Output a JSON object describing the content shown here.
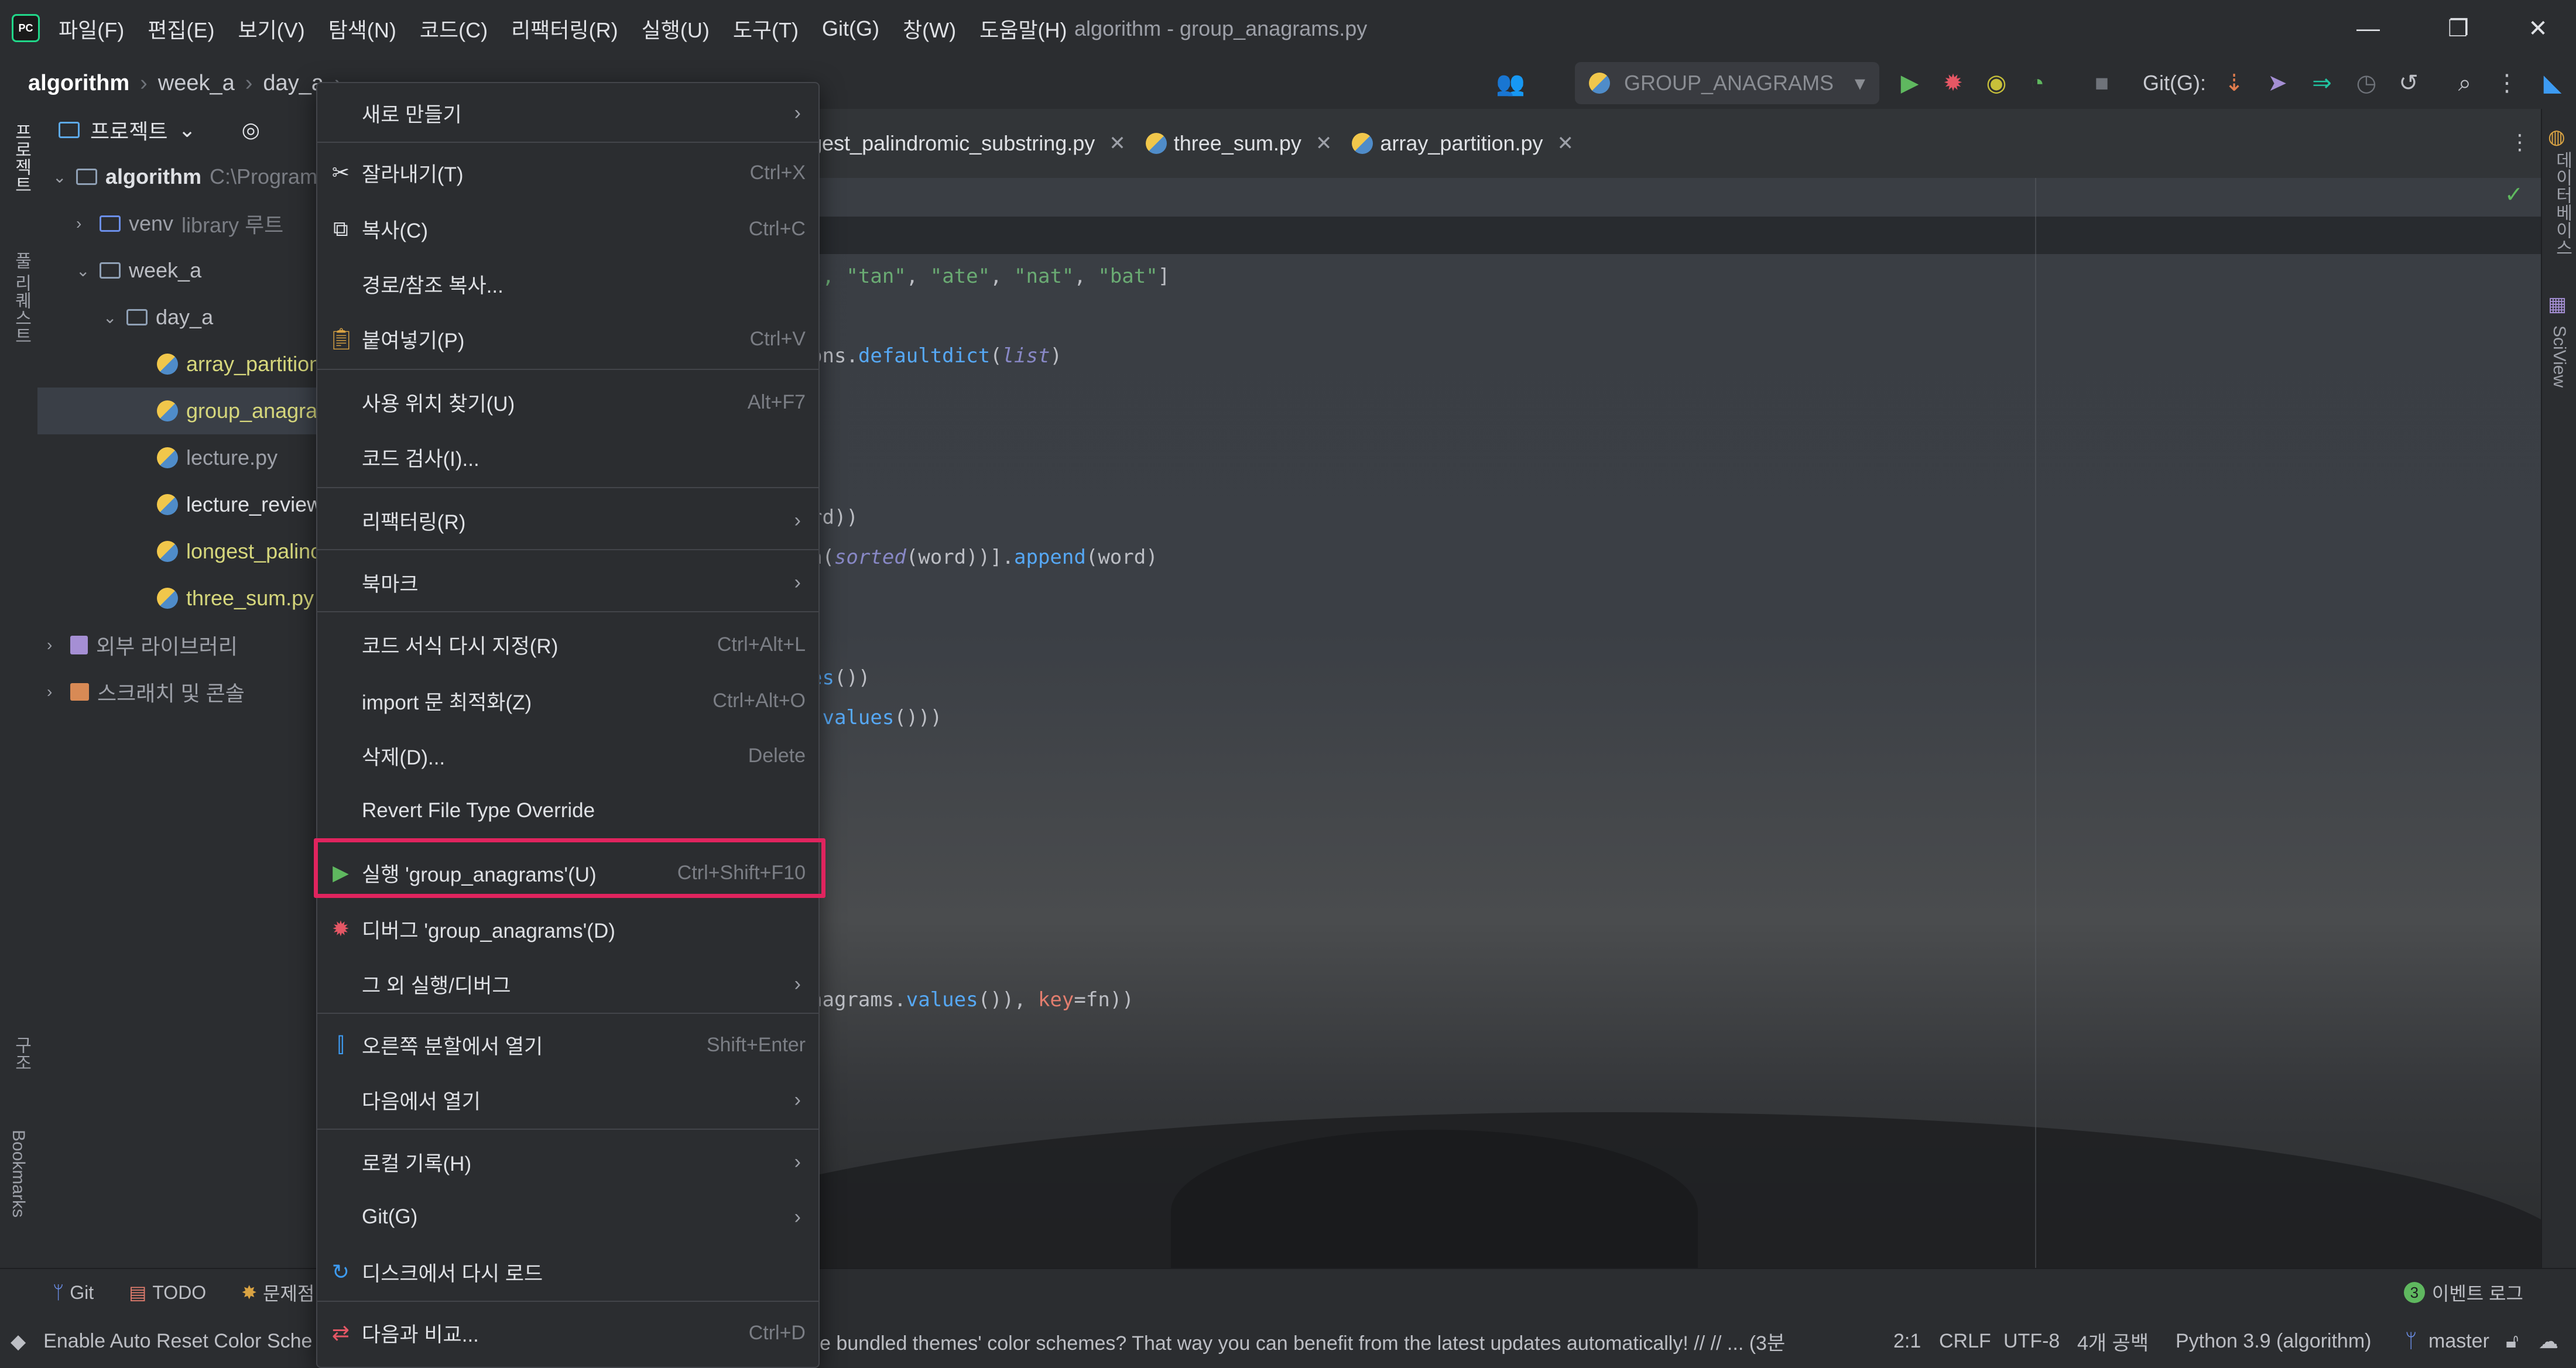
{
  "app": {
    "window_title": "algorithm - group_anagrams.py",
    "menu": [
      "파일(F)",
      "편집(E)",
      "보기(V)",
      "탐색(N)",
      "코드(C)",
      "리팩터링(R)",
      "실행(U)",
      "도구(T)",
      "Git(G)",
      "창(W)",
      "도움말(H)"
    ]
  },
  "breadcrumb": [
    "algorithm",
    "week_a",
    "day_a"
  ],
  "toolbar": {
    "run_config": "GROUP_ANAGRAMS",
    "git_label": "Git(G):"
  },
  "left_strip": {
    "project": "프로젝트",
    "pull_requests": "풀 리퀘스트",
    "structure": "구조",
    "bookmarks": "Bookmarks"
  },
  "right_strip": {
    "database": "데이터베이스",
    "sciview": "SciView"
  },
  "project_panel": {
    "title": "프로젝트",
    "items": [
      {
        "label": "algorithm",
        "hint": "C:\\Program",
        "type": "folder",
        "level": 0
      },
      {
        "label": "venv",
        "hint": "library 루트",
        "type": "folder",
        "level": 1
      },
      {
        "label": "week_a",
        "hint": "",
        "type": "folder",
        "level": 1
      },
      {
        "label": "day_a",
        "hint": "",
        "type": "folder",
        "level": 2
      },
      {
        "label": "array_partition",
        "hint": "",
        "type": "py",
        "level": 3
      },
      {
        "label": "group_anagra",
        "hint": "",
        "type": "py",
        "level": 3
      },
      {
        "label": "lecture.py",
        "hint": "",
        "type": "py",
        "level": 3
      },
      {
        "label": "lecture_review",
        "hint": "",
        "type": "py",
        "level": 3
      },
      {
        "label": "longest_palinc",
        "hint": "",
        "type": "py",
        "level": 3
      },
      {
        "label": "three_sum.py",
        "hint": "",
        "type": "py",
        "level": 3
      },
      {
        "label": "외부 라이브러리",
        "hint": "",
        "type": "lib",
        "level": 0
      },
      {
        "label": "스크래치 및 콘솔",
        "hint": "",
        "type": "scratch",
        "level": 0
      }
    ]
  },
  "tabs": [
    "gest_palindromic_substring.py",
    "three_sum.py",
    "array_partition.py"
  ],
  "code_fragments": {
    "line1_a": "\", ",
    "line1_b": "\"tan\"",
    "line1_c": ", ",
    "line1_d": "\"ate\"",
    "line1_e": ", ",
    "line1_f": "\"nat\"",
    "line1_g": ", ",
    "line1_h": "\"bat\"",
    "line1_i": "]",
    "line2_a": "ons.",
    "line2_b": "defaultdict",
    "line2_c": "(",
    "line2_d": "list",
    "line2_e": ")",
    "line3": "rd))",
    "line4_a": "n(",
    "line4_b": "sorted",
    "line4_c": "(word))].",
    "line4_d": "append",
    "line4_e": "(word)",
    "line5_a": "es",
    "line5_b": "())",
    "line6_a": ".",
    "line6_b": "values",
    "line6_c": "()))",
    "line7_a": "nagrams.",
    "line7_b": "values",
    "line7_c": "()), ",
    "line7_d": "key",
    "line7_e": "=fn))"
  },
  "context_menu": {
    "items": [
      {
        "label": "새로 만들기",
        "shortcut": "",
        "submenu": true,
        "icon": ""
      },
      {
        "label": "잘라내기(T)",
        "shortcut": "Ctrl+X",
        "submenu": false,
        "icon": "scissors-icon"
      },
      {
        "label": "복사(C)",
        "shortcut": "Ctrl+C",
        "submenu": false,
        "icon": "copy-icon"
      },
      {
        "label": "경로/참조 복사...",
        "shortcut": "",
        "submenu": false,
        "icon": ""
      },
      {
        "label": "붙여넣기(P)",
        "shortcut": "Ctrl+V",
        "submenu": false,
        "icon": "paste-icon"
      },
      {
        "label": "사용 위치 찾기(U)",
        "shortcut": "Alt+F7",
        "submenu": false,
        "icon": ""
      },
      {
        "label": "코드 검사(I)...",
        "shortcut": "",
        "submenu": false,
        "icon": ""
      },
      {
        "label": "리팩터링(R)",
        "shortcut": "",
        "submenu": true,
        "icon": ""
      },
      {
        "label": "북마크",
        "shortcut": "",
        "submenu": true,
        "icon": ""
      },
      {
        "label": "코드 서식 다시 지정(R)",
        "shortcut": "Ctrl+Alt+L",
        "submenu": false,
        "icon": ""
      },
      {
        "label": "import 문 최적화(Z)",
        "shortcut": "Ctrl+Alt+O",
        "submenu": false,
        "icon": ""
      },
      {
        "label": "삭제(D)...",
        "shortcut": "Delete",
        "submenu": false,
        "icon": ""
      },
      {
        "label": "Revert File Type Override",
        "shortcut": "",
        "submenu": false,
        "icon": ""
      },
      {
        "label": "실행 'group_anagrams'(U)",
        "shortcut": "Ctrl+Shift+F10",
        "submenu": false,
        "icon": "run-icon"
      },
      {
        "label": "디버그 'group_anagrams'(D)",
        "shortcut": "",
        "submenu": false,
        "icon": "debug-icon"
      },
      {
        "label": "그 외 실행/디버그",
        "shortcut": "",
        "submenu": true,
        "icon": ""
      },
      {
        "label": "오른쪽 분할에서 열기",
        "shortcut": "Shift+Enter",
        "submenu": false,
        "icon": "split-icon"
      },
      {
        "label": "다음에서 열기",
        "shortcut": "",
        "submenu": true,
        "icon": ""
      },
      {
        "label": "로컬 기록(H)",
        "shortcut": "",
        "submenu": true,
        "icon": ""
      },
      {
        "label": "Git(G)",
        "shortcut": "",
        "submenu": true,
        "icon": ""
      },
      {
        "label": "디스크에서 다시 로드",
        "shortcut": "",
        "submenu": false,
        "icon": "reload-icon"
      },
      {
        "label": "다음과 비교...",
        "shortcut": "Ctrl+D",
        "submenu": false,
        "icon": "compare-icon"
      }
    ]
  },
  "bottom_tools": {
    "git": "Git",
    "todo": "TODO",
    "problems": "문제점",
    "event_log_count": "3",
    "event_log": "이벤트 로그"
  },
  "statusbar": {
    "message_left": "Enable Auto Reset Color Sche",
    "message_right": "e bundled themes' color schemes? That way you can benefit from the latest updates automatically! // // ... (3분",
    "position": "2:1",
    "line_sep": "CRLF",
    "encoding": "UTF-8",
    "indent": "4개 공백",
    "interpreter": "Python 3.9 (algorithm)",
    "branch": "master"
  },
  "colors": {
    "highlight_border": "#e0245e",
    "run_green": "#5fb85f",
    "debug_red": "#e55765"
  }
}
